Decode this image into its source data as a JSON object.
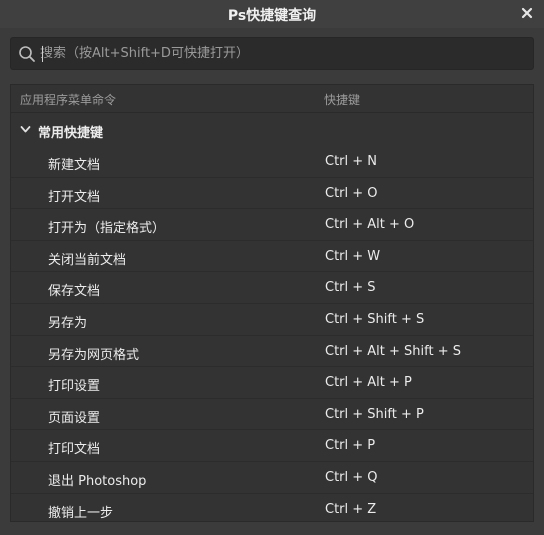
{
  "window": {
    "title": "Ps快捷键查询",
    "close_icon": "close-icon"
  },
  "search": {
    "placeholder": "搜索（按Alt+Shift+D可快捷打开）",
    "value": "",
    "icon": "search-icon"
  },
  "table": {
    "columns": {
      "command": "应用程序菜单命令",
      "shortcut": "快捷键"
    },
    "group": {
      "label": "常用快捷键",
      "expanded": true,
      "icon": "chevron-down-icon"
    },
    "rows": [
      {
        "command": "新建文档",
        "shortcut": "Ctrl + N"
      },
      {
        "command": "打开文档",
        "shortcut": "Ctrl + O"
      },
      {
        "command": "打开为（指定格式）",
        "shortcut": "Ctrl + Alt + O"
      },
      {
        "command": "关闭当前文档",
        "shortcut": "Ctrl + W"
      },
      {
        "command": "保存文档",
        "shortcut": "Ctrl + S"
      },
      {
        "command": "另存为",
        "shortcut": "Ctrl + Shift + S"
      },
      {
        "command": "另存为网页格式",
        "shortcut": "Ctrl + Alt + Shift + S"
      },
      {
        "command": "打印设置",
        "shortcut": "Ctrl + Alt + P"
      },
      {
        "command": "页面设置",
        "shortcut": "Ctrl + Shift + P"
      },
      {
        "command": "打印文档",
        "shortcut": "Ctrl + P"
      },
      {
        "command": "退出 Photoshop",
        "shortcut": "Ctrl + Q"
      },
      {
        "command": "撤销上一步",
        "shortcut": "Ctrl + Z"
      }
    ]
  },
  "colors": {
    "background": "#3b3b3b",
    "panel": "#333333",
    "search_bg": "#2b2b2b",
    "text": "#ececec",
    "muted": "#9c9c9c"
  }
}
